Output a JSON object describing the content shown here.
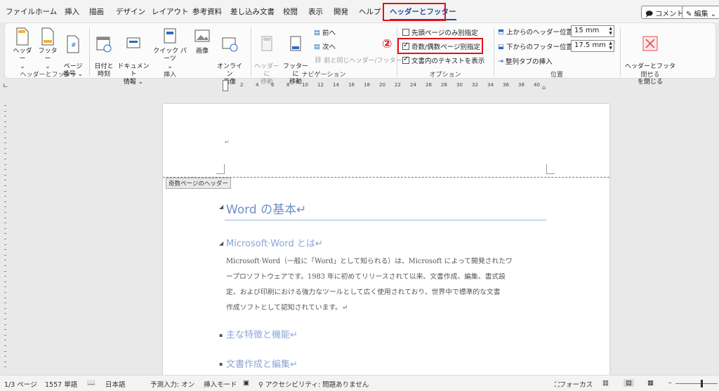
{
  "tabs": [
    "ファイル",
    "ホーム",
    "挿入",
    "描画",
    "デザイン",
    "レイアウト",
    "参考資料",
    "差し込み文書",
    "校閲",
    "表示",
    "開発",
    "ヘルプ",
    "ヘッダーとフッター"
  ],
  "top_right": {
    "comment": "コメント",
    "edit": "編集"
  },
  "ribbon": {
    "hf": {
      "header": "ヘッダー",
      "footer": "フッター",
      "page_num": "ページ\n番号",
      "group": "ヘッダーとフッター"
    },
    "insert": {
      "datetime": "日付と\n時刻",
      "docinfo": "ドキュメント\n情報",
      "quickparts": "クイック パーツ",
      "picture": "画像",
      "online_picture": "オンライン\n画像",
      "group": "挿入"
    },
    "nav": {
      "goto_header": "ヘッダーに\n移動",
      "goto_footer": "フッターに\n移動",
      "prev": "前へ",
      "next": "次へ",
      "link_prev": "前と同じヘッダー/フッター",
      "group": "ナビゲーション"
    },
    "options": {
      "first_page": "先頭ページのみ別指定",
      "odd_even": "奇数/偶数ページ別指定",
      "show_text": "文書内のテキストを表示",
      "group": "オプション"
    },
    "position": {
      "header_from_top_label": "上からのヘッダー位置:",
      "header_from_top_value": "15 mm",
      "footer_from_bottom_label": "下からのフッター位置:",
      "footer_from_bottom_value": "17.5 mm",
      "align_tab": "整列タブの挿入",
      "group": "位置"
    },
    "close": {
      "label": "ヘッダーとフッター\nを閉じる",
      "group": "閉じる"
    }
  },
  "annotation_number": "②",
  "ruler": [
    "2",
    "4",
    "6",
    "8",
    "10",
    "12",
    "14",
    "16",
    "18",
    "20",
    "22",
    "24",
    "26",
    "28",
    "30",
    "32",
    "34",
    "36",
    "38",
    "40"
  ],
  "document": {
    "header_tag": "奇数ページのヘッダー",
    "h1": "Word の基本↵",
    "h2": "Microsoft·Word とは↵",
    "paragraph_lines": [
      "Microsoft·Word（一般に「Word」として知られる）は、Microsoft によって開発されたワ",
      "ープロソフトウェアです。1983 年に初めてリリースされて以来、文書作成、編集、書式設",
      "定、および印刷における強力なツールとして広く使用されており、世界中で標準的な文書",
      "作成ソフトとして認知されています。↵"
    ],
    "h2b": "主な特徴と機能↵",
    "h3": "文書作成と編集↵"
  },
  "status": {
    "page": "1/3 ページ",
    "words": "1557 単語",
    "lang": "日本語",
    "predict": "予測入力: オン",
    "insert_mode": "挿入モード",
    "accessibility": "アクセシビリティ: 問題ありません",
    "focus": "フォーカス"
  },
  "colors": {
    "accent": "#1f4e9c",
    "highlight": "#e0131b",
    "heading": "#6f8fc8"
  }
}
